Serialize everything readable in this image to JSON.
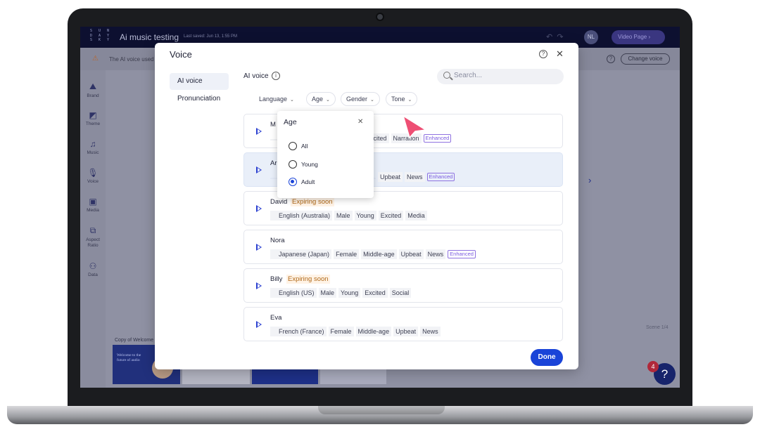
{
  "app": {
    "logo": "SUN\nDAY\nSKY",
    "title": "Ai music testing",
    "last_saved": "Last saved: Jun 13, 1:55 PM",
    "user_initials": "NL",
    "video_page_label": "Video Page",
    "warning_text": "The AI voice used",
    "change_voice_label": "Change voice",
    "sidebar": [
      {
        "label": "Brand",
        "icon": "brand-icon"
      },
      {
        "label": "Theme",
        "icon": "theme-icon"
      },
      {
        "label": "Music",
        "icon": "music-icon"
      },
      {
        "label": "Voice",
        "icon": "microphone-icon"
      },
      {
        "label": "Media",
        "icon": "media-icon"
      },
      {
        "label": "Aspect Ratio",
        "icon": "aspect-ratio-icon"
      },
      {
        "label": "Data",
        "icon": "data-icon"
      }
    ],
    "scene_label": "Scene 1/4",
    "filmstrip_label": "Copy of Welcome",
    "thumb_text": "Welcome to the future of audio",
    "notification_count": "4",
    "help_label": "?"
  },
  "modal": {
    "title": "Voice",
    "nav": [
      {
        "label": "AI voice",
        "active": true
      },
      {
        "label": "Pronunciation",
        "active": false
      }
    ],
    "section_label": "AI voice",
    "search_placeholder": "Search...",
    "filters": [
      "Language",
      "Age",
      "Gender",
      "Tone"
    ],
    "age_popover": {
      "title": "Age",
      "options": [
        "All",
        "Young",
        "Adult"
      ],
      "selected": "Adult"
    },
    "voices": [
      {
        "name": "M",
        "expiring": "",
        "tags": [
          "",
          "",
          "",
          "Excited",
          "Narration"
        ],
        "enhanced": "Enhanced",
        "selected": false
      },
      {
        "name": "Ar",
        "expiring": "",
        "tags": [
          "",
          "",
          "",
          "Upbeat",
          "News"
        ],
        "enhanced": "Enhanced",
        "selected": true
      },
      {
        "name": "David",
        "expiring": "Expiring soon",
        "tags": [
          "English (Australia)",
          "Male",
          "Young",
          "Excited",
          "Media"
        ],
        "enhanced": "",
        "selected": false
      },
      {
        "name": "Nora",
        "expiring": "",
        "tags": [
          "Japanese (Japan)",
          "Female",
          "Middle-age",
          "Upbeat",
          "News"
        ],
        "enhanced": "Enhanced",
        "selected": false
      },
      {
        "name": "Billy",
        "expiring": "Expiring soon",
        "tags": [
          "English (US)",
          "Male",
          "Young",
          "Excited",
          "Social"
        ],
        "enhanced": "",
        "selected": false
      },
      {
        "name": "Eva",
        "expiring": "",
        "tags": [
          "French (France)",
          "Female",
          "Middle-age",
          "Upbeat",
          "News"
        ],
        "enhanced": "",
        "selected": false
      }
    ],
    "done_label": "Done"
  },
  "colors": {
    "primary": "#1a44d8",
    "expiring_text": "#b06a1a",
    "enhanced_border": "#8f72e0",
    "cursor": "#ee4f74"
  }
}
